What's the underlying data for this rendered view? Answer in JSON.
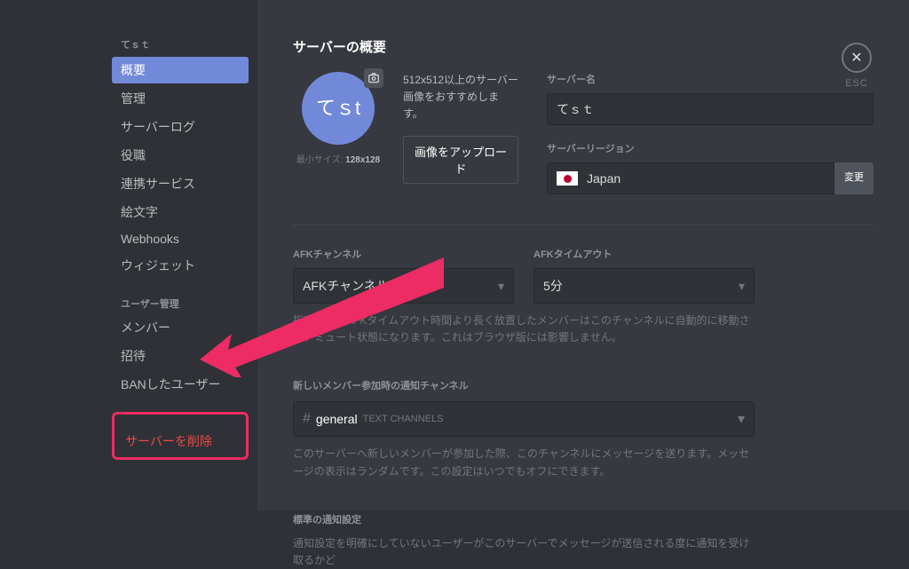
{
  "sidebar": {
    "server_name": "てｓｔ",
    "items": [
      "概要",
      "管理",
      "サーバーログ",
      "役職",
      "連携サービス",
      "絵文字",
      "Webhooks",
      "ウィジェット"
    ],
    "user_mgmt_heading": "ユーザー管理",
    "user_items": [
      "メンバー",
      "招待",
      "BANしたユーザー"
    ],
    "delete_label": "サーバーを削除"
  },
  "close": {
    "label": "ESC"
  },
  "page": {
    "title": "サーバーの概要",
    "avatar_initials": "てｓt",
    "min_size_label": "最小サイズ:",
    "min_size_value": "128x128",
    "image_hint": "512x512以上のサーバー画像をおすすめします。",
    "upload_button": "画像をアップロード",
    "server_name_label": "サーバー名",
    "server_name_value": "てｓｔ",
    "region_label": "サーバーリージョン",
    "region_value": "Japan",
    "region_change": "変更",
    "afk_channel_label": "AFKチャンネル",
    "afk_channel_value": "AFKチャンネルなし",
    "afk_timeout_label": "AFKタイムアウト",
    "afk_timeout_value": "5分",
    "afk_help": "指定されたAFKタイムアウト時間より長く放置したメンバーはこのチャンネルに自動的に移動され、ミュート状態になります。これはブラウザ版には影響しません。",
    "new_member_heading": "新しいメンバー参加時の通知チャンネル",
    "channel_name": "general",
    "channel_category": "TEXT CHANNELS",
    "new_member_help": "このサーバーへ新しいメンバーが参加した際、このチャンネルにメッセージを送ります。メッセージの表示はランダムです。この設定はいつでもオフにできます。",
    "default_notif_heading": "標準の通知設定",
    "default_notif_help": "通知設定を明確にしていないユーザーがこのサーバーでメッセージが送信される度に通知を受け取るかど"
  }
}
